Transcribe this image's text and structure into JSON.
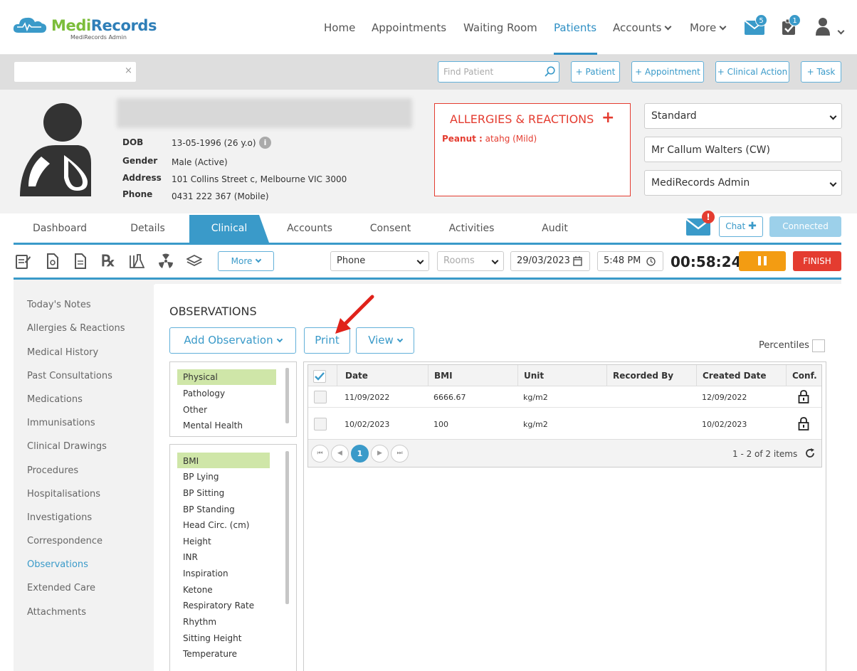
{
  "brand": {
    "name_part1": "Medi",
    "name_part2": "Records",
    "subtitle": "MediRecords Admin"
  },
  "nav": {
    "items": [
      {
        "label": "Home"
      },
      {
        "label": "Appointments"
      },
      {
        "label": "Waiting Room"
      },
      {
        "label": "Patients",
        "active": true
      },
      {
        "label": "Accounts"
      },
      {
        "label": "More"
      }
    ],
    "mail_badge": "5",
    "tasks_badge": "1"
  },
  "search": {
    "find_placeholder": "Find Patient",
    "clear_icon": "×",
    "buttons": [
      "+ Patient",
      "+ Appointment",
      "+ Clinical Action",
      "+ Task"
    ]
  },
  "patient": {
    "labels": {
      "dob": "DOB",
      "gender": "Gender",
      "address": "Address",
      "phone": "Phone"
    },
    "dob": "13-05-1996 (26 y.o)",
    "gender": "Male (Active)",
    "address": "101 Collins Street c, Melbourne VIC 3000",
    "phone": "0431 222 367 (Mobile)"
  },
  "allergies": {
    "title": "ALLERGIES & REACTIONS",
    "plus": "+",
    "item_name": "Peanut :",
    "item_detail": "atahg (Mild)"
  },
  "right_panel": {
    "template": "Standard",
    "practitioner": "Mr Callum Walters (CW)",
    "location": "MediRecords Admin"
  },
  "tabs": [
    "Dashboard",
    "Details",
    "Clinical",
    "Accounts",
    "Consent",
    "Activities",
    "Audit"
  ],
  "active_tab": "Clinical",
  "chat": {
    "alert": "!",
    "chat_label": "Chat",
    "chat_plus": "✚",
    "connected_label": "Connected"
  },
  "toolbar": {
    "more_label": "More",
    "encounter_type": "Phone",
    "rooms_placeholder": "Rooms",
    "date": "29/03/2023",
    "time": "5:48 PM",
    "timer": "00:58:24",
    "finish_label": "FINISH"
  },
  "sidebar": {
    "items": [
      "Today's Notes",
      "Allergies & Reactions",
      "Medical History",
      "Past Consultations",
      "Medications",
      "Immunisations",
      "Clinical Drawings",
      "Procedures",
      "Hospitalisations",
      "Investigations",
      "Correspondence",
      "Observations",
      "Extended Care",
      "Attachments"
    ],
    "active": "Observations"
  },
  "observations": {
    "title": "OBSERVATIONS",
    "add_label": "Add Observation",
    "print_label": "Print",
    "view_label": "View",
    "percentiles_label": "Percentiles",
    "categories": [
      "Physical",
      "Pathology",
      "Other",
      "Mental Health"
    ],
    "selected_category": "Physical",
    "types": [
      "BMI",
      "BP Lying",
      "BP Sitting",
      "BP Standing",
      "Head Circ. (cm)",
      "Height",
      "INR",
      "Inspiration",
      "Ketone",
      "Respiratory Rate",
      "Rhythm",
      "Sitting Height",
      "Temperature"
    ],
    "selected_type": "BMI",
    "table": {
      "columns": [
        "Date",
        "BMI",
        "Unit",
        "Recorded By",
        "Created Date",
        "Conf."
      ],
      "rows": [
        {
          "date": "11/09/2022",
          "bmi": "6666.67",
          "unit": "kg/m2",
          "recorded_by": "",
          "created": "12/09/2022"
        },
        {
          "date": "10/02/2023",
          "bmi": "100",
          "unit": "kg/m2",
          "recorded_by": "",
          "created": "10/02/2023"
        }
      ]
    },
    "pager": {
      "current": "1",
      "info": "1 - 2 of 2 items"
    }
  },
  "colors": {
    "accent": "#3a9ac9",
    "brand_green": "#7cbd3b",
    "brand_blue": "#2f7fb8",
    "alert": "#e43c30",
    "pause": "#f39c12"
  }
}
